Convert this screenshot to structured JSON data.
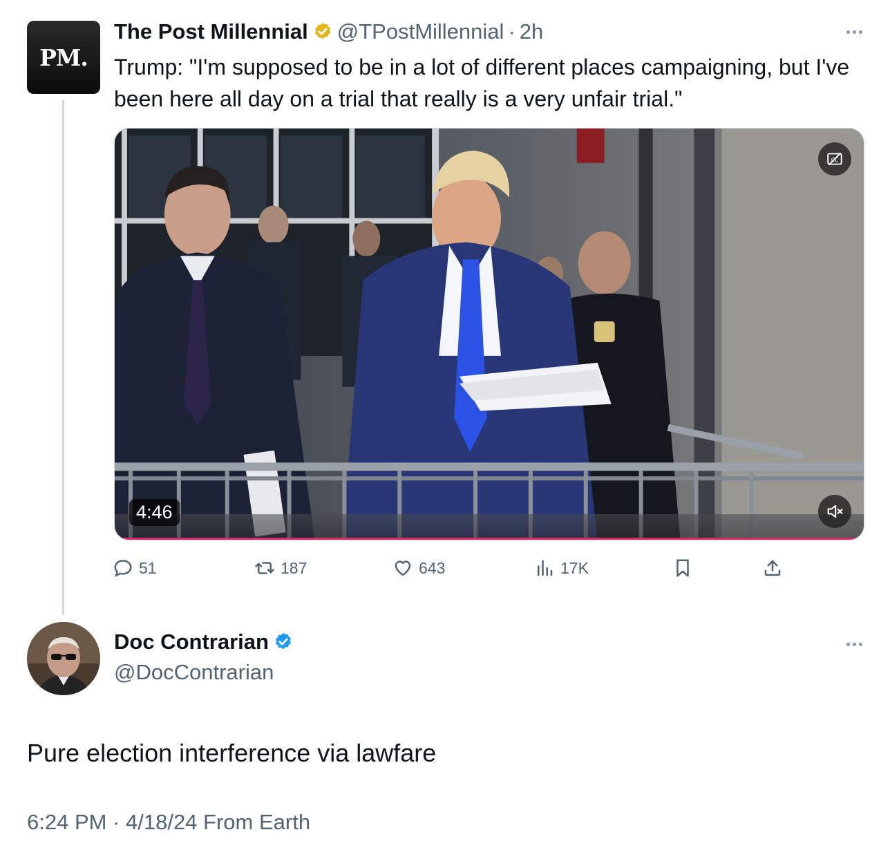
{
  "parent_tweet": {
    "avatar_text": "PM.",
    "name": "The Post Millennial",
    "verified_badge": "gold-check-icon",
    "handle": "@TPostMillennial",
    "separator": "·",
    "time": "2h",
    "text": "Trump: \"I'm supposed to be in a lot of different places campaigning, but I've been here all day on a trial that really is a very unfair trial.\"",
    "video": {
      "duration": "4:46",
      "captions_icon": "captions-off-icon",
      "mute_icon": "speaker-muted-icon"
    },
    "actions": {
      "replies": "51",
      "reposts": "187",
      "likes": "643",
      "views": "17K"
    }
  },
  "reply_tweet": {
    "name": "Doc Contrarian",
    "verified_badge": "blue-check-icon",
    "handle": "@DocContrarian",
    "text": "Pure election interference via lawfare",
    "meta": "6:24 PM · 4/18/24 From Earth"
  },
  "colors": {
    "text": "#0f1419",
    "secondary": "#536471",
    "gold_badge": "#e2b719",
    "blue_badge": "#1d9bf0",
    "thread_line": "#cfd9de"
  }
}
